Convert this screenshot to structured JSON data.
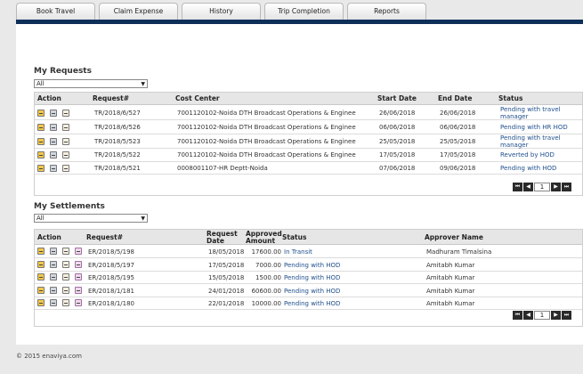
{
  "tabs": [
    {
      "label": "Book Travel"
    },
    {
      "label": "Claim Expense"
    },
    {
      "label": "History"
    },
    {
      "label": "Trip Completion"
    },
    {
      "label": "Reports"
    }
  ],
  "requests": {
    "title": "My Requests",
    "filter": "All",
    "columns": {
      "action": "Action",
      "request": "Request#",
      "cost_center": "Cost Center",
      "start": "Start Date",
      "end": "End Date",
      "status": "Status"
    },
    "rows": [
      {
        "request": "TR/2018/6/527",
        "cost_center": "7001120102-Noida DTH Broadcast Operations & Enginee",
        "start": "26/06/2018",
        "end": "26/06/2018",
        "status": "Pending with travel manager"
      },
      {
        "request": "TR/2018/6/526",
        "cost_center": "7001120102-Noida DTH Broadcast Operations & Enginee",
        "start": "06/06/2018",
        "end": "06/06/2018",
        "status": "Pending with HR HOD"
      },
      {
        "request": "TR/2018/5/523",
        "cost_center": "7001120102-Noida DTH Broadcast Operations & Enginee",
        "start": "25/05/2018",
        "end": "25/05/2018",
        "status": "Pending with travel manager"
      },
      {
        "request": "TR/2018/5/522",
        "cost_center": "7001120102-Noida DTH Broadcast Operations & Enginee",
        "start": "17/05/2018",
        "end": "17/05/2018",
        "status": "Reverted by HOD"
      },
      {
        "request": "TR/2018/5/521",
        "cost_center": "0008001107-HR Deptt-Noida",
        "start": "07/06/2018",
        "end": "09/06/2018",
        "status": "Pending with HOD"
      }
    ],
    "page": "1"
  },
  "settlements": {
    "title": "My Settlements",
    "filter": "All",
    "columns": {
      "action": "Action",
      "request": "Request#",
      "request_date_1": "Request",
      "request_date_2": "Date",
      "amount_1": "Approved",
      "amount_2": "Amount",
      "status": "Status",
      "approver": "Approver Name"
    },
    "rows": [
      {
        "request": "ER/2018/5/198",
        "date": "18/05/2018",
        "amount": "17600.00",
        "status": "In Transit",
        "approver": "Madhuram Timalsina"
      },
      {
        "request": "ER/2018/5/197",
        "date": "17/05/2018",
        "amount": "7000.00",
        "status": "Pending with HOD",
        "approver": "Amitabh Kumar"
      },
      {
        "request": "ER/2018/5/195",
        "date": "15/05/2018",
        "amount": "1500.00",
        "status": "Pending with HOD",
        "approver": "Amitabh Kumar"
      },
      {
        "request": "ER/2018/1/181",
        "date": "24/01/2018",
        "amount": "60600.00",
        "status": "Pending with HOD",
        "approver": "Amitabh Kumar"
      },
      {
        "request": "ER/2018/1/180",
        "date": "22/01/2018",
        "amount": "10000.00",
        "status": "Pending with HOD",
        "approver": "Amitabh Kumar"
      }
    ],
    "page": "1"
  },
  "pager": {
    "first": "⏮",
    "prev": "◀",
    "next": "▶",
    "last": "⏭"
  },
  "footer": "© 2015 enaviya.com"
}
